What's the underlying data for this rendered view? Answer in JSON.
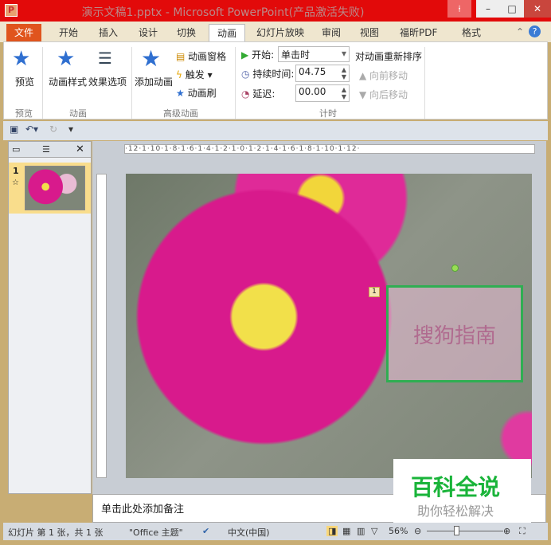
{
  "window": {
    "title": "演示文稿1.pptx - Microsoft PowerPoint(产品激活失败)",
    "app_icon": "P",
    "minimize": "–",
    "maximize": "□",
    "close": "✕"
  },
  "tabs": [
    "文件",
    "开始",
    "插入",
    "设计",
    "切换",
    "动画",
    "幻灯片放映",
    "审阅",
    "视图",
    "福昕PDF",
    "格式"
  ],
  "ribbon": {
    "preview": {
      "label": "预览",
      "group": "预览"
    },
    "animation": {
      "styles": "动画样式",
      "effects": "效果选项",
      "group": "动画"
    },
    "advanced": {
      "add": "添加动画",
      "pane": "动画窗格",
      "trigger": "触发",
      "painter": "动画刷",
      "group": "高级动画"
    },
    "timing": {
      "start_label": "开始:",
      "start_value": "单击时",
      "duration_label": "持续时间:",
      "duration_value": "04.75",
      "delay_label": "延迟:",
      "delay_value": "00.00",
      "reorder": "对动画重新排序",
      "move_earlier": "向前移动",
      "move_later": "向后移动",
      "group": "计时"
    }
  },
  "thumbnail": {
    "number": "1",
    "star": "☆"
  },
  "ruler": "·12·1·10·1·8·1·6·1·4·1·2·1·0·1·2·1·4·1·6·1·8·1·10·1·12·",
  "slide": {
    "textbox": "搜狗指南",
    "anim_badge": "1"
  },
  "notes": {
    "placeholder": "单击此处添加备注"
  },
  "status": {
    "slide": "幻灯片 第 1 张，共 1 张",
    "theme": "\"Office 主题\"",
    "lang": "中文(中国)",
    "zoom": "56%",
    "zoom_fraction": 0.4
  },
  "watermark": {
    "line1": "百科全说",
    "line2": "助你轻松解决"
  }
}
